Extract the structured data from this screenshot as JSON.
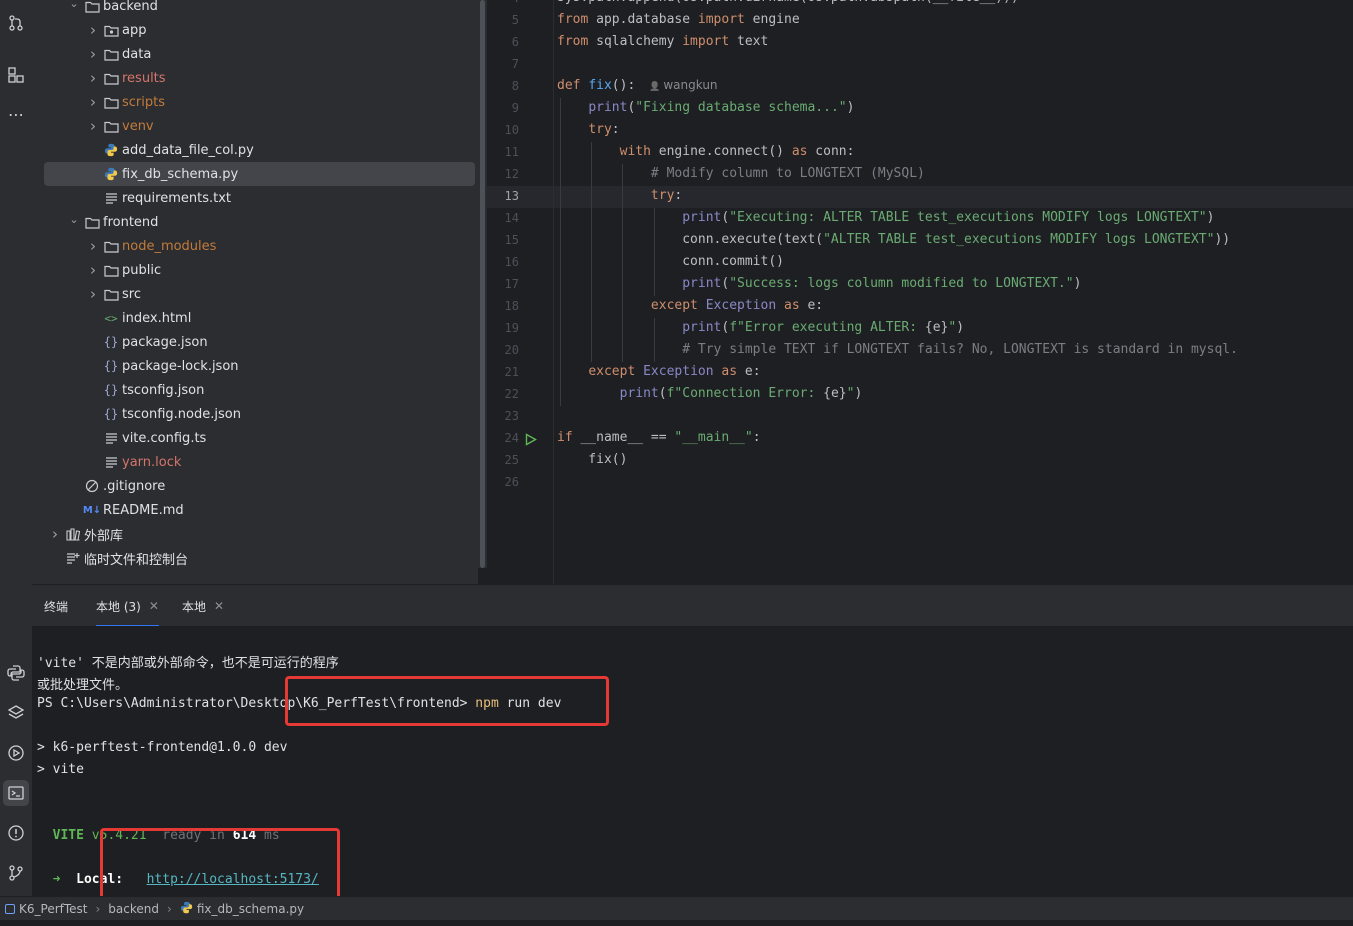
{
  "tree": {
    "items": [
      {
        "label": "backend",
        "type": "folder",
        "expanded": true,
        "depth": 2,
        "color": "normal"
      },
      {
        "label": "app",
        "type": "package",
        "expanded": false,
        "depth": 3,
        "color": "normal"
      },
      {
        "label": "data",
        "type": "folder",
        "expanded": false,
        "depth": 3,
        "color": "normal"
      },
      {
        "label": "results",
        "type": "folder",
        "expanded": false,
        "depth": 3,
        "color": "ignored"
      },
      {
        "label": "scripts",
        "type": "folder",
        "expanded": false,
        "depth": 3,
        "color": "muted"
      },
      {
        "label": "venv",
        "type": "folder",
        "expanded": false,
        "depth": 3,
        "color": "muted"
      },
      {
        "label": "add_data_file_col.py",
        "type": "python",
        "depth": 3,
        "color": "normal"
      },
      {
        "label": "fix_db_schema.py",
        "type": "python",
        "depth": 3,
        "color": "normal",
        "selected": true
      },
      {
        "label": "requirements.txt",
        "type": "text",
        "depth": 3,
        "color": "normal"
      },
      {
        "label": "frontend",
        "type": "folder",
        "expanded": true,
        "depth": 2,
        "color": "normal"
      },
      {
        "label": "node_modules",
        "type": "folder",
        "expanded": false,
        "depth": 3,
        "color": "muted"
      },
      {
        "label": "public",
        "type": "folder",
        "expanded": false,
        "depth": 3,
        "color": "normal"
      },
      {
        "label": "src",
        "type": "folder",
        "expanded": false,
        "depth": 3,
        "color": "normal"
      },
      {
        "label": "index.html",
        "type": "html",
        "depth": 3,
        "color": "normal"
      },
      {
        "label": "package.json",
        "type": "json",
        "depth": 3,
        "color": "normal"
      },
      {
        "label": "package-lock.json",
        "type": "json",
        "depth": 3,
        "color": "normal"
      },
      {
        "label": "tsconfig.json",
        "type": "json",
        "depth": 3,
        "color": "normal"
      },
      {
        "label": "tsconfig.node.json",
        "type": "json",
        "depth": 3,
        "color": "normal"
      },
      {
        "label": "vite.config.ts",
        "type": "text",
        "depth": 3,
        "color": "normal"
      },
      {
        "label": "yarn.lock",
        "type": "text",
        "depth": 3,
        "color": "ignored"
      },
      {
        "label": ".gitignore",
        "type": "ignore",
        "depth": 2,
        "color": "normal"
      },
      {
        "label": "README.md",
        "type": "markdown",
        "depth": 2,
        "color": "normal"
      },
      {
        "label": "外部库",
        "type": "library",
        "expanded": false,
        "depth": 1,
        "color": "normal"
      },
      {
        "label": "临时文件和控制台",
        "type": "scratch",
        "depth": 1,
        "color": "normal"
      }
    ]
  },
  "editor": {
    "current_line": 13,
    "inlay_author": "wangkun",
    "lines": [
      {
        "n": "4",
        "html": "<span>sys.path.append(os.path.dirname(os.path.abspath(__file__)))</span>"
      },
      {
        "n": "5",
        "html": "<span class='kw'>from</span> app.database <span class='kw'>import</span> engine"
      },
      {
        "n": "6",
        "html": "<span class='kw'>from</span> sqlalchemy <span class='kw'>import</span> text"
      },
      {
        "n": "7",
        "html": ""
      },
      {
        "n": "8",
        "html": "<span class='kw'>def</span> <span class='fn'>fix</span>():"
      },
      {
        "n": "9",
        "html": "    <span class='bi'>print</span>(<span class='str'>\"Fixing database schema...\"</span>)"
      },
      {
        "n": "10",
        "html": "    <span class='kw'>try</span>:"
      },
      {
        "n": "11",
        "html": "        <span class='kw'>with</span> engine.connect() <span class='kw'>as</span> conn:"
      },
      {
        "n": "12",
        "html": "            <span class='cm'># Modify column to LONGTEXT (MySQL)</span>"
      },
      {
        "n": "13",
        "html": "            <span class='kw'>try</span>:"
      },
      {
        "n": "14",
        "html": "                <span class='bi'>print</span>(<span class='str'>\"Executing: ALTER TABLE test_executions MODIFY logs LONGTEXT\"</span>)"
      },
      {
        "n": "15",
        "html": "                conn.execute(text(<span class='str'>\"ALTER TABLE test_executions MODIFY logs LONGTEXT\"</span>))"
      },
      {
        "n": "16",
        "html": "                conn.commit()"
      },
      {
        "n": "17",
        "html": "                <span class='bi'>print</span>(<span class='str'>\"Success: logs column modified to LONGTEXT.\"</span>)"
      },
      {
        "n": "18",
        "html": "            <span class='kw'>except</span> <span class='bi'>Exception</span> <span class='kw'>as</span> e:"
      },
      {
        "n": "19",
        "html": "                <span class='bi'>print</span>(<span class='str'>f\"Error executing ALTER: </span>{e}<span class='str'>\"</span>)"
      },
      {
        "n": "20",
        "html": "                <span class='cm'># Try simple TEXT if LONGTEXT fails? No, LONGTEXT is standard in mysql.</span>"
      },
      {
        "n": "21",
        "html": "    <span class='kw'>except</span> <span class='bi'>Exception</span> <span class='kw'>as</span> e:"
      },
      {
        "n": "22",
        "html": "        <span class='bi'>print</span>(<span class='str'>f\"Connection Error: </span>{e}<span class='str'>\"</span>)"
      },
      {
        "n": "23",
        "html": ""
      },
      {
        "n": "24",
        "html": "<span class='kw'>if</span> __name__ == <span class='str'>\"__main__\"</span>:"
      },
      {
        "n": "25",
        "html": "    fix()"
      },
      {
        "n": "26",
        "html": ""
      }
    ]
  },
  "panel": {
    "tabs": [
      {
        "label": "终端",
        "closable": false,
        "active": false
      },
      {
        "label": "本地 (3)",
        "closable": true,
        "active": true
      },
      {
        "label": "本地",
        "closable": true,
        "active": false
      }
    ]
  },
  "terminal": {
    "line1": "'vite' 不是内部或外部命令，也不是可运行的程序",
    "line2": "或批处理文件。",
    "prompt": "PS C:\\Users\\Administrator\\Desktop\\K6_PerfTest\\frontend> ",
    "cmd_npm": "npm",
    "cmd_rest": " run dev",
    "script1": "> k6-perftest-frontend@1.0.0 dev",
    "script2": "> vite",
    "vite_label": "VITE",
    "vite_version": "v5.4.21",
    "vite_ready": "ready in",
    "vite_ms": "614",
    "vite_ms_unit": "ms",
    "arrow": "➜",
    "local_label": "Local:",
    "local_url": "http://localhost:5173/"
  },
  "statusbar": {
    "crumbs": [
      "K6_PerfTest",
      "backend",
      "fix_db_schema.py"
    ]
  },
  "colors": {
    "accent": "#3574f0",
    "highlight_box": "#e53935"
  }
}
